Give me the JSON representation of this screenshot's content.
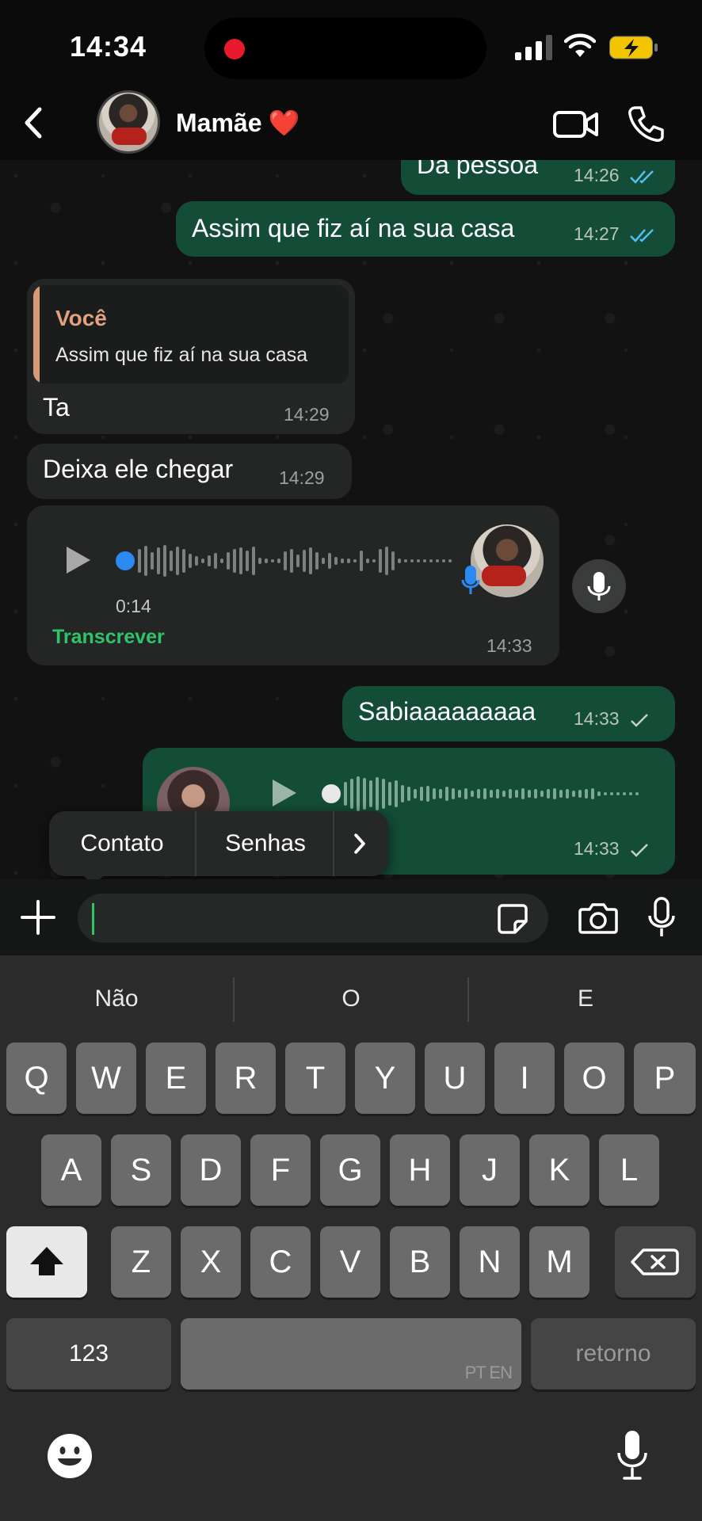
{
  "status_bar": {
    "time": "14:34"
  },
  "header": {
    "contact_name": "Mamãe",
    "contact_emoji": "❤️"
  },
  "messages": [
    {
      "text": "Da pessoa",
      "time": "14:26",
      "ticks": "read"
    },
    {
      "text": "Assim que fiz aí na sua casa",
      "time": "14:27",
      "ticks": "read"
    },
    {
      "quote_author": "Você",
      "quote_text": "Assim que fiz aí na sua casa",
      "text": "Ta",
      "time": "14:29"
    },
    {
      "text": "Deixa ele chegar",
      "time": "14:29"
    },
    {
      "voice_duration": "0:14",
      "transcribe_label": "Transcrever",
      "time": "14:33"
    },
    {
      "text": "Sabiaaaaaaaaa",
      "time": "14:33",
      "ticks": "sent"
    },
    {
      "time": "14:33",
      "ticks": "sent"
    }
  ],
  "context_menu": {
    "items": [
      "Contato",
      "Senhas"
    ]
  },
  "composer": {
    "value": ""
  },
  "keyboard": {
    "suggestions": [
      "Não",
      "O",
      "E"
    ],
    "row1": [
      "Q",
      "W",
      "E",
      "R",
      "T",
      "Y",
      "U",
      "I",
      "O",
      "P"
    ],
    "row2": [
      "A",
      "S",
      "D",
      "F",
      "G",
      "H",
      "J",
      "K",
      "L"
    ],
    "row3": [
      "Z",
      "X",
      "C",
      "V",
      "B",
      "N",
      "M"
    ],
    "numbers_label": "123",
    "space_lang": "PT EN",
    "return_label": "retorno"
  },
  "colors": {
    "outgoing_bubble": "#144d37",
    "incoming_bubble": "#242626",
    "accent_green": "#2fc46a",
    "quote_author": "#e3a27e",
    "read_tick": "#53bdeb",
    "recording_dot": "#e8192c"
  },
  "icons": [
    "back-chevron-icon",
    "video-call-icon",
    "phone-call-icon",
    "plus-icon",
    "sticker-icon",
    "camera-icon",
    "mic-icon",
    "play-icon",
    "emoji-icon",
    "dictation-mic-icon",
    "backspace-icon",
    "shift-icon"
  ]
}
